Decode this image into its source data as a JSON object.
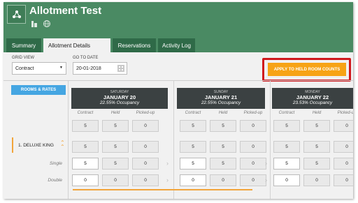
{
  "header": {
    "title": "Allotment Test",
    "colors": {
      "header_bg": "#4a8a63",
      "tab_bg": "#2f6a48"
    }
  },
  "tabs": [
    {
      "label": "Summary",
      "active": false
    },
    {
      "label": "Allotment Details",
      "active": true
    },
    {
      "label": "Reservations",
      "active": false
    },
    {
      "label": "Activity Log",
      "active": false
    }
  ],
  "toolbar": {
    "grid_view_label": "GRID VIEW",
    "grid_view_value": "Contract",
    "go_to_date_label": "GO TO DATE",
    "go_to_date_value": "20-01-2018",
    "apply_button": "APPLY TO HELD ROOM COUNTS",
    "rooms_rates_button": "ROOMS & RATES"
  },
  "days": [
    {
      "dow": "SATURDAY",
      "date": "JANUARY 20",
      "occupancy": "22.55% Occupancy"
    },
    {
      "dow": "SUNDAY",
      "date": "JANUARY 21",
      "occupancy": "22.55% Occupancy"
    },
    {
      "dow": "MONDAY",
      "date": "JANUARY 22",
      "occupancy": "23.53% Occupancy"
    }
  ],
  "column_headers": [
    "Contract",
    "Held",
    "Picked-up"
  ],
  "rows": {
    "room_name": "1. DELUXE KING",
    "single_label": "Single",
    "double_label": "Double"
  },
  "values": {
    "total": [
      [
        "5",
        "5",
        "0"
      ],
      [
        "5",
        "5",
        "0"
      ],
      [
        "5",
        "5",
        "0"
      ]
    ],
    "room": [
      [
        "5",
        "5",
        "0"
      ],
      [
        "5",
        "5",
        "0"
      ],
      [
        "5",
        "5",
        "0"
      ]
    ],
    "single": [
      [
        "5",
        "5",
        "0"
      ],
      [
        "5",
        "5",
        "0"
      ],
      [
        "5",
        "5",
        "0"
      ]
    ],
    "double": [
      [
        "0",
        "0",
        "0"
      ],
      [
        "0",
        "0",
        "0"
      ],
      [
        "0",
        "0",
        "0"
      ]
    ]
  }
}
